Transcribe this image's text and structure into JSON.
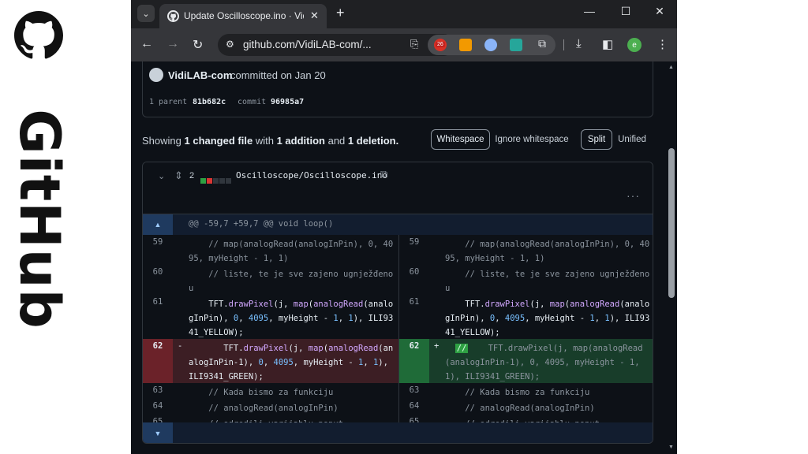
{
  "branding": {
    "wordmark": "GitHub",
    "logo_icon": "github-octocat-icon"
  },
  "browser": {
    "tab": {
      "title": "Update Oscilloscope.ino · VidiLAB-com",
      "favicon": "github-icon",
      "close_icon": "close-icon"
    },
    "new_tab_icon": "plus-icon",
    "window_controls": [
      "minimize-icon",
      "maximize-icon",
      "close-icon"
    ],
    "toolbar": {
      "url": "github.com/VidiLAB-com/...",
      "extension_badge": "26",
      "profile_initial": "e"
    }
  },
  "commit": {
    "author": "VidiLAB-com",
    "action_text": "committed on Jan 20",
    "parent_label": "1 parent",
    "parent_sha": "81b682c",
    "commit_label": "commit",
    "commit_sha": "96985a7"
  },
  "summary": {
    "prefix": "Showing",
    "changed": "1 changed file",
    "with": "with",
    "additions": "1 addition",
    "and": "and",
    "deletions": "1 deletion."
  },
  "view_options": {
    "whitespace": "Whitespace",
    "ignore_whitespace": "Ignore whitespace",
    "split": "Split",
    "unified": "Unified"
  },
  "file": {
    "change_count": "2",
    "path": "Oscilloscope/Oscilloscope.ino",
    "more": "···",
    "hunk_header": "@@ -59,7 +59,7 @@ void loop()"
  },
  "colors": {
    "addition": "#2ea043",
    "deletion": "#da3633",
    "accent_blue": "#1f3a5f"
  },
  "diff": {
    "left": [
      {
        "num": "59",
        "sign": "",
        "type": "ctx",
        "lines": 2,
        "tokens": [
          {
            "t": "comment",
            "v": "    // map(analogRead(analogInPin), 0, 4095, myHeight - 1, 1)"
          }
        ]
      },
      {
        "num": "60",
        "sign": "",
        "type": "ctx",
        "lines": 2,
        "tokens": [
          {
            "t": "comment",
            "v": "    // liste, te je sve zajeno ugnježđeno u"
          }
        ]
      },
      {
        "num": "61",
        "sign": "",
        "type": "ctx",
        "lines": 3,
        "tokens": [
          {
            "t": "plain",
            "v": "    TFT."
          },
          {
            "t": "fn",
            "v": "drawPixel"
          },
          {
            "t": "plain",
            "v": "(j, "
          },
          {
            "t": "fn",
            "v": "map"
          },
          {
            "t": "plain",
            "v": "("
          },
          {
            "t": "fn",
            "v": "analogRead"
          },
          {
            "t": "plain",
            "v": "(analogInPin), "
          },
          {
            "t": "num",
            "v": "0"
          },
          {
            "t": "plain",
            "v": ", "
          },
          {
            "t": "num",
            "v": "4095"
          },
          {
            "t": "plain",
            "v": ", myHeight - "
          },
          {
            "t": "num",
            "v": "1"
          },
          {
            "t": "plain",
            "v": ", "
          },
          {
            "t": "num",
            "v": "1"
          },
          {
            "t": "plain",
            "v": "), ILI9341_YELLOW);"
          }
        ]
      },
      {
        "num": "62",
        "sign": "-",
        "type": "del",
        "lines": 3,
        "tokens": [
          {
            "t": "plain",
            "v": "       TFT."
          },
          {
            "t": "fn",
            "v": "drawPixel"
          },
          {
            "t": "plain",
            "v": "(j, "
          },
          {
            "t": "fn",
            "v": "map"
          },
          {
            "t": "plain",
            "v": "("
          },
          {
            "t": "fn",
            "v": "analogRead"
          },
          {
            "t": "plain",
            "v": "(analogInPin-1), "
          },
          {
            "t": "num",
            "v": "0"
          },
          {
            "t": "plain",
            "v": ", "
          },
          {
            "t": "num",
            "v": "4095"
          },
          {
            "t": "plain",
            "v": ", myHeight - "
          },
          {
            "t": "num",
            "v": "1"
          },
          {
            "t": "plain",
            "v": ", "
          },
          {
            "t": "num",
            "v": "1"
          },
          {
            "t": "plain",
            "v": "), ILI9341_GREEN);"
          }
        ]
      },
      {
        "num": "63",
        "sign": "",
        "type": "ctx",
        "lines": 1,
        "tokens": [
          {
            "t": "comment",
            "v": "    // Kada bismo za funkciju"
          }
        ]
      },
      {
        "num": "64",
        "sign": "",
        "type": "ctx",
        "lines": 1,
        "tokens": [
          {
            "t": "comment",
            "v": "    // analogRead(analogInPin)"
          }
        ]
      },
      {
        "num": "65",
        "sign": "",
        "type": "ctx",
        "lines": 1,
        "tokens": [
          {
            "t": "comment",
            "v": "    // odredili varijablu poput"
          }
        ]
      }
    ],
    "right": [
      {
        "num": "59",
        "sign": "",
        "type": "ctx",
        "lines": 2,
        "tokens": [
          {
            "t": "comment",
            "v": "    // map(analogRead(analogInPin), 0, 4095, myHeight - 1, 1)"
          }
        ]
      },
      {
        "num": "60",
        "sign": "",
        "type": "ctx",
        "lines": 2,
        "tokens": [
          {
            "t": "comment",
            "v": "    // liste, te je sve zajeno ugnježđeno u"
          }
        ]
      },
      {
        "num": "61",
        "sign": "",
        "type": "ctx",
        "lines": 3,
        "tokens": [
          {
            "t": "plain",
            "v": "    TFT."
          },
          {
            "t": "fn",
            "v": "drawPixel"
          },
          {
            "t": "plain",
            "v": "(j, "
          },
          {
            "t": "fn",
            "v": "map"
          },
          {
            "t": "plain",
            "v": "("
          },
          {
            "t": "fn",
            "v": "analogRead"
          },
          {
            "t": "plain",
            "v": "(analogInPin), "
          },
          {
            "t": "num",
            "v": "0"
          },
          {
            "t": "plain",
            "v": ", "
          },
          {
            "t": "num",
            "v": "4095"
          },
          {
            "t": "plain",
            "v": ", myHeight - "
          },
          {
            "t": "num",
            "v": "1"
          },
          {
            "t": "plain",
            "v": ", "
          },
          {
            "t": "num",
            "v": "1"
          },
          {
            "t": "plain",
            "v": "), ILI9341_YELLOW);"
          }
        ]
      },
      {
        "num": "62",
        "sign": "+",
        "type": "add",
        "lines": 3,
        "tokens": [
          {
            "t": "plain",
            "v": "  "
          },
          {
            "t": "hl",
            "v": "//"
          },
          {
            "t": "comment",
            "v": "    TFT.drawPixel(j, map(analogRead(analogInPin-1), 0, 4095, myHeight - 1, 1), ILI9341_GREEN);"
          }
        ]
      },
      {
        "num": "63",
        "sign": "",
        "type": "ctx",
        "lines": 1,
        "tokens": [
          {
            "t": "comment",
            "v": "    // Kada bismo za funkciju"
          }
        ]
      },
      {
        "num": "64",
        "sign": "",
        "type": "ctx",
        "lines": 1,
        "tokens": [
          {
            "t": "comment",
            "v": "    // analogRead(analogInPin)"
          }
        ]
      },
      {
        "num": "65",
        "sign": "",
        "type": "ctx",
        "lines": 1,
        "tokens": [
          {
            "t": "comment",
            "v": "    // odredili varijablu poput"
          }
        ]
      }
    ]
  }
}
